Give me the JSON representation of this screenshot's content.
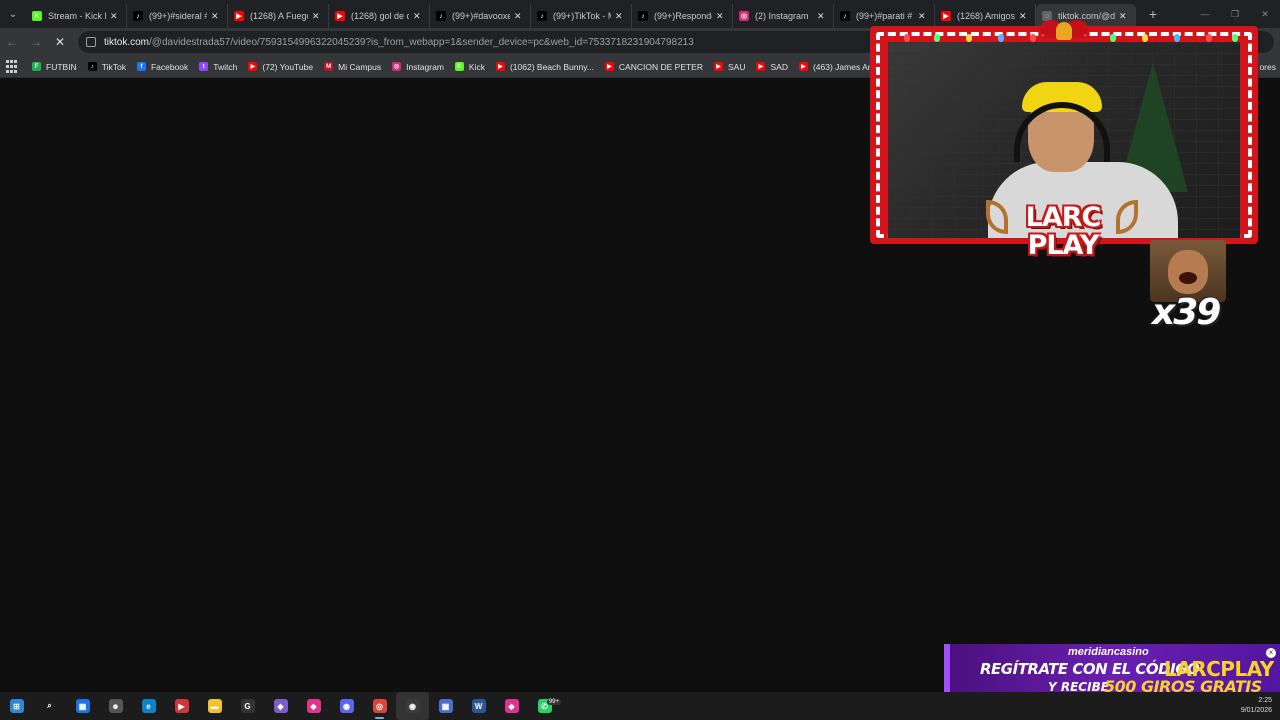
{
  "browser": {
    "tabs": [
      {
        "title": "Stream - Kick L",
        "icon": "kick-icon",
        "color": "#53fc18",
        "glyph": "K",
        "active": false
      },
      {
        "title": "(99+)#sideral #",
        "icon": "tiktok-icon",
        "color": "#000000",
        "glyph": "♪",
        "active": false
      },
      {
        "title": "(1268) A Fuego",
        "icon": "youtube-icon",
        "color": "#ff0000",
        "glyph": "▶",
        "active": false
      },
      {
        "title": "(1268) gol de c",
        "icon": "youtube-icon",
        "color": "#ff0000",
        "glyph": "▶",
        "active": false
      },
      {
        "title": "(99+)#davooxe",
        "icon": "tiktok-icon",
        "color": "#000000",
        "glyph": "♪",
        "active": false
      },
      {
        "title": "(99+)TikTok - M",
        "icon": "tiktok-icon",
        "color": "#000000",
        "glyph": "♪",
        "active": false
      },
      {
        "title": "(99+)Responde",
        "icon": "tiktok-icon",
        "color": "#000000",
        "glyph": "♪",
        "active": false
      },
      {
        "title": "(2) Instagram",
        "icon": "instagram-icon",
        "color": "#d62976",
        "glyph": "◎",
        "active": false
      },
      {
        "title": "(99+)#parati #",
        "icon": "tiktok-icon",
        "color": "#000000",
        "glyph": "♪",
        "active": false
      },
      {
        "title": "(1268) Amigos",
        "icon": "youtube-icon",
        "color": "#ff0000",
        "glyph": "▶",
        "active": false
      },
      {
        "title": "tiktok.com/@d",
        "icon": "loading-icon",
        "color": "#5f6368",
        "glyph": "◌",
        "active": true
      }
    ],
    "address": {
      "host": "tiktok.com",
      "path": "/@davidestrada57/video/7593154996322045239?is_from_webapp=1&sender_device=pc&web_id=7533718231904798213"
    },
    "bookmarks": [
      {
        "label": "FUTBIN",
        "icon": "futbin-icon",
        "color": "#1fb34f",
        "glyph": "F"
      },
      {
        "label": "TikTok",
        "icon": "tiktok-icon",
        "color": "#000000",
        "glyph": "♪"
      },
      {
        "label": "Facebook",
        "icon": "facebook-icon",
        "color": "#1877f2",
        "glyph": "f"
      },
      {
        "label": "Twitch",
        "icon": "twitch-icon",
        "color": "#9146ff",
        "glyph": "t"
      },
      {
        "label": "(72) YouTube",
        "icon": "youtube-icon",
        "color": "#ff0000",
        "glyph": "▶"
      },
      {
        "label": "Mi Campus",
        "icon": "campus-icon",
        "color": "#c1121f",
        "glyph": "M"
      },
      {
        "label": "Instagram",
        "icon": "instagram-icon",
        "color": "#d62976",
        "glyph": "◎"
      },
      {
        "label": "Kick",
        "icon": "kick-icon",
        "color": "#53fc18",
        "glyph": "K"
      },
      {
        "label": "(1062) Beach Bunny...",
        "icon": "youtube-icon",
        "color": "#ff0000",
        "glyph": "▶"
      },
      {
        "label": "CANCION DE PETER",
        "icon": "youtube-icon",
        "color": "#ff0000",
        "glyph": "▶"
      },
      {
        "label": "SAU",
        "icon": "youtube-icon",
        "color": "#ff0000",
        "glyph": "▶"
      },
      {
        "label": "SAD",
        "icon": "youtube-icon",
        "color": "#ff0000",
        "glyph": "▶"
      },
      {
        "label": "(463) James Arthur -...",
        "icon": "youtube-icon",
        "color": "#ff0000",
        "glyph": "▶"
      }
    ],
    "bookmarks_more": "ores"
  },
  "overlay": {
    "logo_line1": "LARC",
    "logo_line2": "PLAY",
    "combo": "x39",
    "banner": {
      "brand": "meridiancasino",
      "line1": "REGÍTRATE CON EL CÓDIGO",
      "code": "LARCPLAY",
      "line2a": "Y RECIBE",
      "line2b": "500 GIROS GRATIS"
    }
  },
  "taskbar": {
    "apps": [
      {
        "name": "start-button",
        "color": "#2b88d8",
        "glyph": "⊞"
      },
      {
        "name": "search-icon",
        "color": "transparent",
        "glyph": "⌕"
      },
      {
        "name": "store-icon",
        "color": "#1a73e8",
        "glyph": "▦"
      },
      {
        "name": "cat-app-icon",
        "color": "#555555",
        "glyph": "☻"
      },
      {
        "name": "edge-icon",
        "color": "#0a84c7",
        "glyph": "e"
      },
      {
        "name": "media-app-icon",
        "color": "#d1343a",
        "glyph": "▶"
      },
      {
        "name": "file-explorer-icon",
        "color": "#f2c230",
        "glyph": "▬"
      },
      {
        "name": "epic-games-icon",
        "color": "#333333",
        "glyph": "G"
      },
      {
        "name": "game-app-icon",
        "color": "#7b5cc9",
        "glyph": "◆"
      },
      {
        "name": "app-pink-icon",
        "color": "#e0338f",
        "glyph": "◆"
      },
      {
        "name": "discord-app-icon",
        "color": "#5865f2",
        "glyph": "◉"
      },
      {
        "name": "chrome-icon",
        "color": "#db4437",
        "glyph": "◎"
      },
      {
        "name": "obs-icon",
        "color": "#3a3a3a",
        "glyph": "◉"
      },
      {
        "name": "calculator-icon",
        "color": "#4a6dd1",
        "glyph": "▦"
      },
      {
        "name": "word-icon",
        "color": "#2b579a",
        "glyph": "W"
      },
      {
        "name": "app-pink2-icon",
        "color": "#e0338f",
        "glyph": "◆"
      },
      {
        "name": "whatsapp-icon",
        "color": "#25d366",
        "glyph": "✆",
        "badge": "99+"
      }
    ],
    "time": "2:25",
    "date": "9/01/2026"
  }
}
